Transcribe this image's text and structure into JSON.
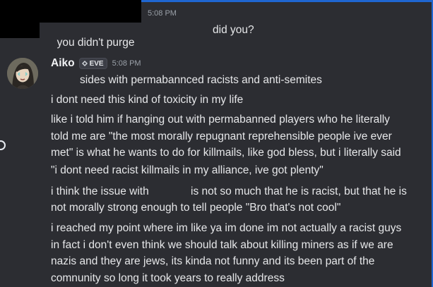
{
  "previous_message": {
    "timestamp": "5:08 PM",
    "text_part1": "you didn't purge",
    "text_part2": "did you?"
  },
  "message": {
    "author": "Aiko",
    "tag": "EVE",
    "timestamp": "5:08 PM",
    "lines": [
      "sides with permabannced racists and anti-semites",
      "i dont need this kind of toxicity in my life",
      "like i told him if hanging out with permabanned players who he literally",
      "told me are \"the most morally repugnant reprehensible people ive ever",
      "met\" is what he wants to do for killmails, like god bless, but i literally said",
      "\"i dont need racist killmails in my alliance, ive got plenty\"",
      "i think the issue with",
      "not morally strong enough to tell people \"Bro that's not cool\"",
      "i reached my point where im like ya im done im not actually a racist guys",
      "in fact i don't even think we should talk about killing miners as if we are",
      "nazis and they are jews, its kinda not funny and its been part of the",
      "comnunity so long it took years to really address"
    ],
    "line6_part2": "is not so much that he is racist, but that he is"
  },
  "colors": {
    "background": "#2c2d32",
    "accent_border": "#1f66d1",
    "redaction": "#000000"
  },
  "icons": {
    "tag_icon": "eve-diamond-icon",
    "avatar": "avatar"
  }
}
